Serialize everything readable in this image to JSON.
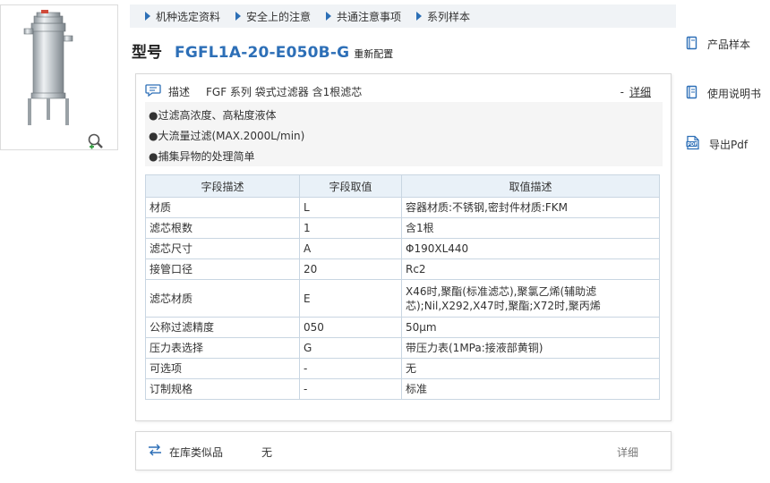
{
  "breadcrumbs": [
    "机种选定资料",
    "安全上的注意",
    "共通注意事项",
    "系列样本"
  ],
  "model": {
    "label": "型号",
    "code": "FGFL1A-20-E050B-G",
    "reset": "重新配置"
  },
  "description": {
    "label": "描述",
    "title": "FGF 系列 袋式过滤器 含1根滤芯",
    "detail_dash": "-",
    "detail_link": "详细",
    "features": [
      "●过滤高浓度、高粘度液体",
      "●大流量过滤(MAX.2000L/min)",
      "●捕集异物的处理简单"
    ]
  },
  "table": {
    "headers": [
      "字段描述",
      "字段取值",
      "取值描述"
    ],
    "rows": [
      {
        "field": "材质",
        "value": "L",
        "desc": "容器材质:不锈钢,密封件材质:FKM"
      },
      {
        "field": "滤芯根数",
        "value": "1",
        "desc": "含1根"
      },
      {
        "field": "滤芯尺寸",
        "value": "A",
        "desc": "Φ190XL440"
      },
      {
        "field": "接管口径",
        "value": "20",
        "desc": "Rc2"
      },
      {
        "field": "滤芯材质",
        "value": "E",
        "desc": "X46时,聚酯(标准滤芯),聚氯乙烯(辅助滤芯);Nil,X292,X47时,聚酯;X72时,聚丙烯"
      },
      {
        "field": "公称过滤精度",
        "value": "050",
        "desc": "50μm"
      },
      {
        "field": "压力表选择",
        "value": "G",
        "desc": "带压力表(1MPa:接液部黄铜)"
      },
      {
        "field": "可选项",
        "value": "-",
        "desc": "无"
      },
      {
        "field": "订制规格",
        "value": "-",
        "desc": "标准"
      }
    ]
  },
  "side_links": [
    {
      "label": "产品样本",
      "icon": "book-icon"
    },
    {
      "label": "使用说明书",
      "icon": "manual-icon"
    },
    {
      "label": "导出Pdf",
      "icon": "pdf-icon"
    }
  ],
  "stock": {
    "label": "在库类似品",
    "value": "无",
    "detail": "详细"
  },
  "colors": {
    "accent": "#2d6fb7",
    "table_header": "#e9f1f8",
    "border": "#c9d6e2",
    "feature_bg": "#f5f5f5"
  }
}
